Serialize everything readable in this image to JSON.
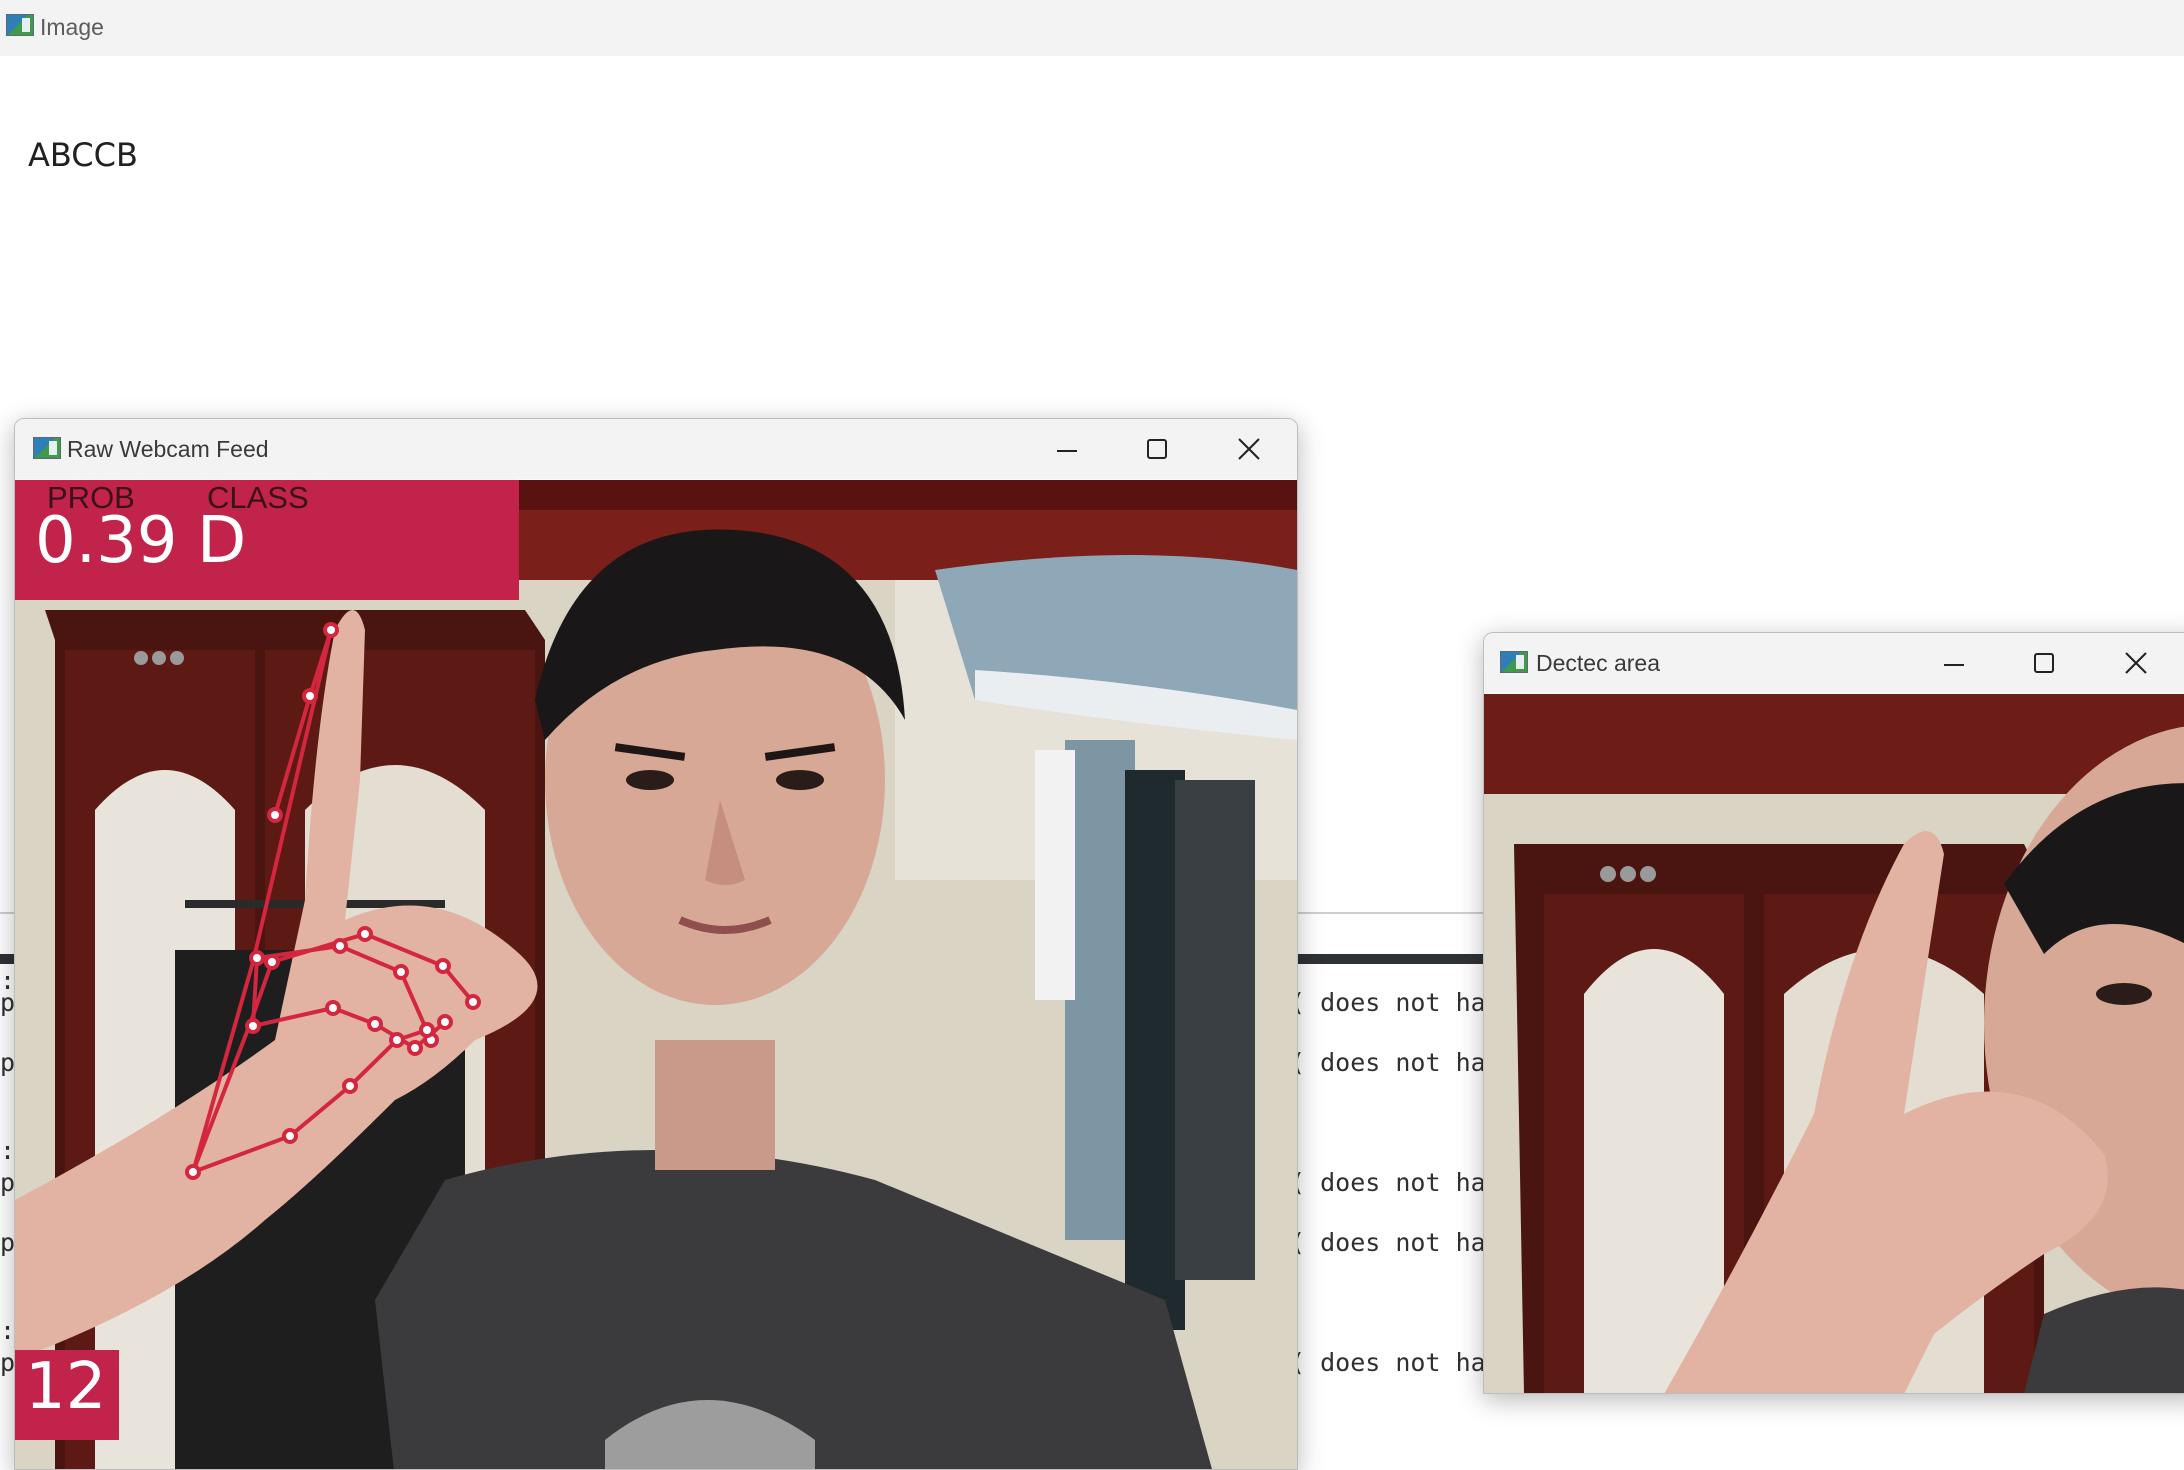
{
  "main_window": {
    "title": "Image",
    "recognized_text": "ABCCB"
  },
  "console": {
    "left_fragments": [
      ":",
      "p",
      "p",
      ":",
      "p",
      "p",
      ":",
      "p"
    ],
    "right_fragments": [
      "( does not hav",
      "( does not hav",
      "( does not hav",
      "( does not hav",
      "( does not hav"
    ]
  },
  "webcam_window": {
    "title": "Raw Webcam Feed",
    "prob_label": "PROB",
    "class_label": "CLASS",
    "prob_value": "0.39",
    "class_value": "D",
    "frame_counter": "12",
    "overlay_color": "#c2234a"
  },
  "detect_window": {
    "title": "Dectec area"
  },
  "icons": {
    "app": "opencv-window-icon",
    "minimize": "minimize-icon",
    "maximize": "maximize-icon",
    "close": "close-icon"
  }
}
